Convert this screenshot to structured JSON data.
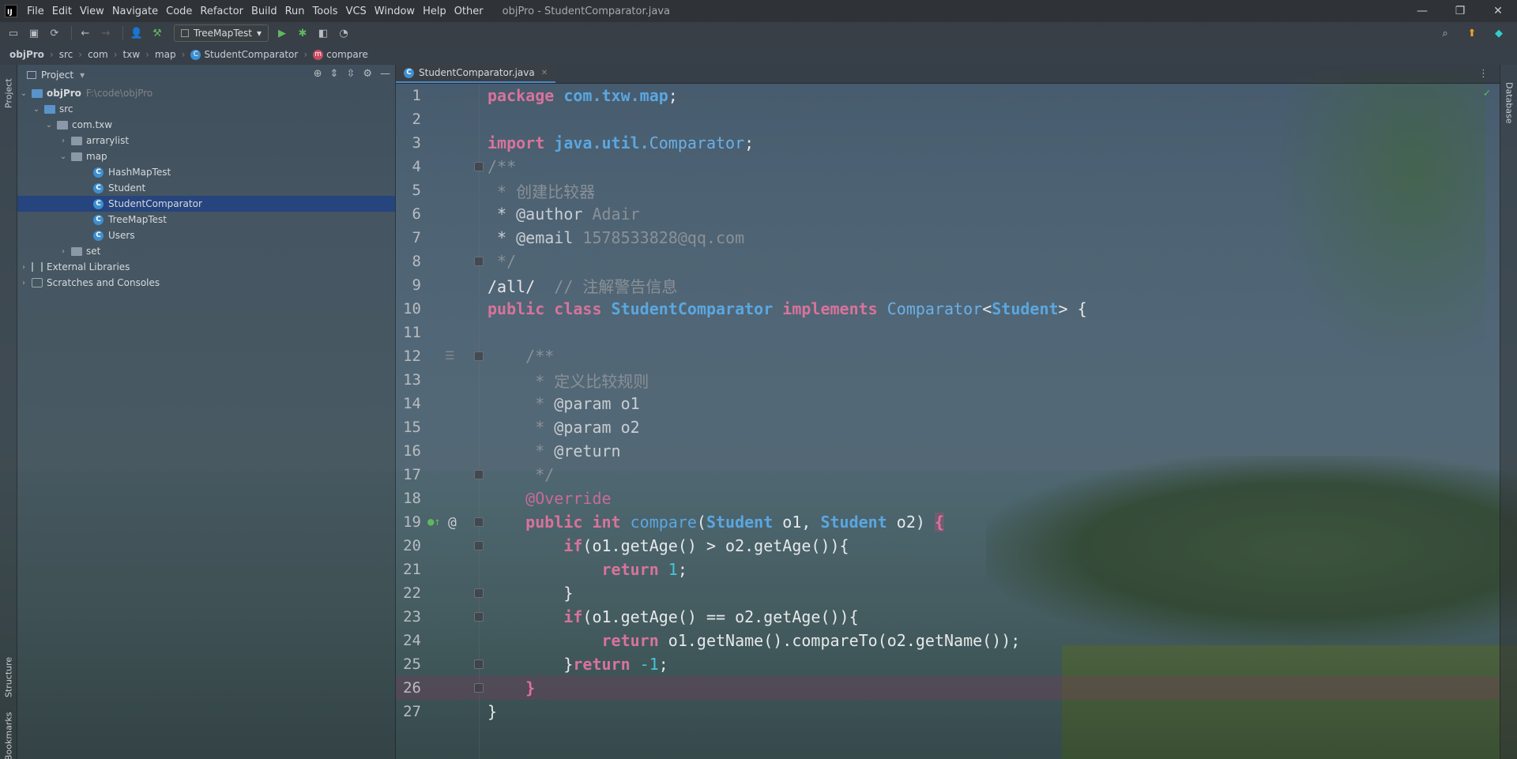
{
  "menubar": {
    "logo": "IJ",
    "items": [
      "File",
      "Edit",
      "View",
      "Navigate",
      "Code",
      "Refactor",
      "Build",
      "Run",
      "Tools",
      "VCS",
      "Window",
      "Help",
      "Other"
    ],
    "title": "objPro - StudentComparator.java",
    "controls": [
      "—",
      "❐",
      "✕"
    ]
  },
  "toolbar": {
    "run_config": "TreeMapTest"
  },
  "breadcrumb": [
    "objPro",
    "src",
    "com",
    "txw",
    "map",
    "StudentComparator",
    "compare"
  ],
  "left_stripe": {
    "project": "Project",
    "structure": "Structure",
    "bookmarks": "Bookmarks"
  },
  "right_stripe": {
    "database": "Database"
  },
  "project_panel": {
    "title": "Project",
    "tree": [
      {
        "label": "objPro",
        "hint": "F:\\code\\objPro"
      },
      {
        "label": "src"
      },
      {
        "label": "com.txw"
      },
      {
        "label": "arrarylist"
      },
      {
        "label": "map"
      },
      {
        "label": "HashMapTest"
      },
      {
        "label": "Student"
      },
      {
        "label": "StudentComparator"
      },
      {
        "label": "TreeMapTest"
      },
      {
        "label": "Users"
      },
      {
        "label": "set"
      },
      {
        "label": "External Libraries"
      },
      {
        "label": "Scratches and Consoles"
      }
    ]
  },
  "editor": {
    "tab_label": "StudentComparator.java",
    "line_numbers": [
      "1",
      "2",
      "3",
      "4",
      "5",
      "6",
      "7",
      "8",
      "9",
      "10",
      "11",
      "12",
      "13",
      "14",
      "15",
      "16",
      "17",
      "18",
      "19",
      "20",
      "21",
      "22",
      "23",
      "24",
      "25",
      "26",
      "27"
    ],
    "code": {
      "l1_kw": "package",
      "l1_pkg": "com.txw.map",
      "l1_end": ";",
      "l3_kw": "import",
      "l3_pkg": "java.util.",
      "l3_type": "Comparator",
      "l3_end": ";",
      "l4": "/**",
      "l5": " * 创建比较器",
      "l6_tag": " * @author",
      "l6_val": " Adair",
      "l7_tag": " * @email",
      "l7_val": " 1578533828@qq.com",
      "l8": " */",
      "l9_code": "/all/",
      "l9_cmt": "  // 注解警告信息",
      "l10_kw": "public class",
      "l10_name": "StudentComparator",
      "l10_kw2": "implements",
      "l10_type": "Comparator",
      "l10_lt": "<",
      "l10_gen": "Student",
      "l10_end": "> {",
      "l12": "    /**",
      "l13": "     * 定义比较规则",
      "l14_star": "     * ",
      "l14_tag": "@param o1",
      "l15_star": "     * ",
      "l15_tag": "@param o2",
      "l16_star": "     * ",
      "l16_tag": "@return",
      "l17": "     */",
      "l18": "    @Override",
      "l19_kw": "    public int",
      "l19_m": " compare",
      "l19_p1": "(",
      "l19_t1": "Student",
      "l19_a1": " o1, ",
      "l19_t2": "Student",
      "l19_a2": " o2) ",
      "l19_brace": "{",
      "l20_kw": "        if",
      "l20_rest": "(o1.getAge() > o2.getAge()){",
      "l21_kw": "            return",
      "l21_num": " 1",
      "l21_end": ";",
      "l22": "        }",
      "l23_kw": "        if",
      "l23_rest": "(o1.getAge() == o2.getAge()){",
      "l24_kw": "            return",
      "l24_rest": " o1.getName().compareTo(o2.getName());",
      "l25_b": "        }",
      "l25_kw": "return",
      "l25_num": " -1",
      "l25_end": ";",
      "l26": "    }",
      "l27": "}"
    }
  },
  "colors": {
    "keyword": "#d8739b",
    "type": "#5aa7e0",
    "comment": "#8b9096",
    "number": "#46c5d9",
    "selection": "#214283"
  }
}
